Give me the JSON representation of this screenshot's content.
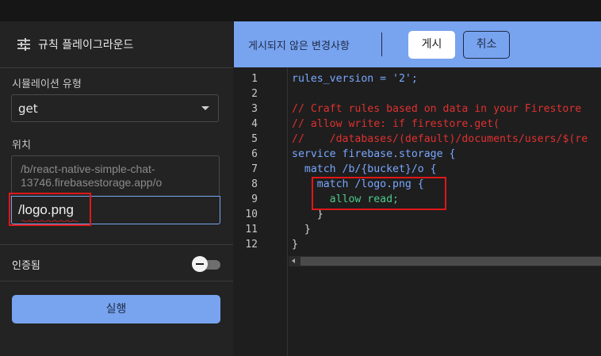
{
  "left_panel": {
    "title": "규칙 플레이그라운드",
    "sim_type_label": "시뮬레이션 유형",
    "sim_type_value": "get",
    "location_label": "위치",
    "location_prefix": "/b/react-native-simple-chat-13746.firebasestorage.app/o",
    "location_value": "/logo.png",
    "auth_label": "인증됨",
    "auth_enabled": false,
    "run_label": "실행"
  },
  "topbar": {
    "unpublished_label": "게시되지 않은 변경사항",
    "publish_label": "게시",
    "cancel_label": "취소"
  },
  "editor": {
    "line_numbers": [
      "1",
      "2",
      "3",
      "4",
      "5",
      "6",
      "7",
      "8",
      "9",
      "10",
      "11",
      "12"
    ],
    "lines": [
      "rules_version = '2';",
      "",
      "// Craft rules based on data in your Firestore",
      "// allow write: if firestore.get(",
      "//    /databases/(default)/documents/users/$(re",
      "service firebase.storage {",
      "  match /b/{bucket}/o {",
      "    match /logo.png {",
      "      allow read;",
      "    }",
      "  }",
      "}"
    ]
  },
  "colors": {
    "accent": "#78a3ef",
    "highlight_box": "#e01818",
    "keyword": "#79a7ff",
    "comment": "#e03030",
    "string": "#e36a6a",
    "permission": "#4ec98a"
  },
  "icons": [
    "tune-icon",
    "dropdown-caret-icon",
    "toggle-icon"
  ]
}
